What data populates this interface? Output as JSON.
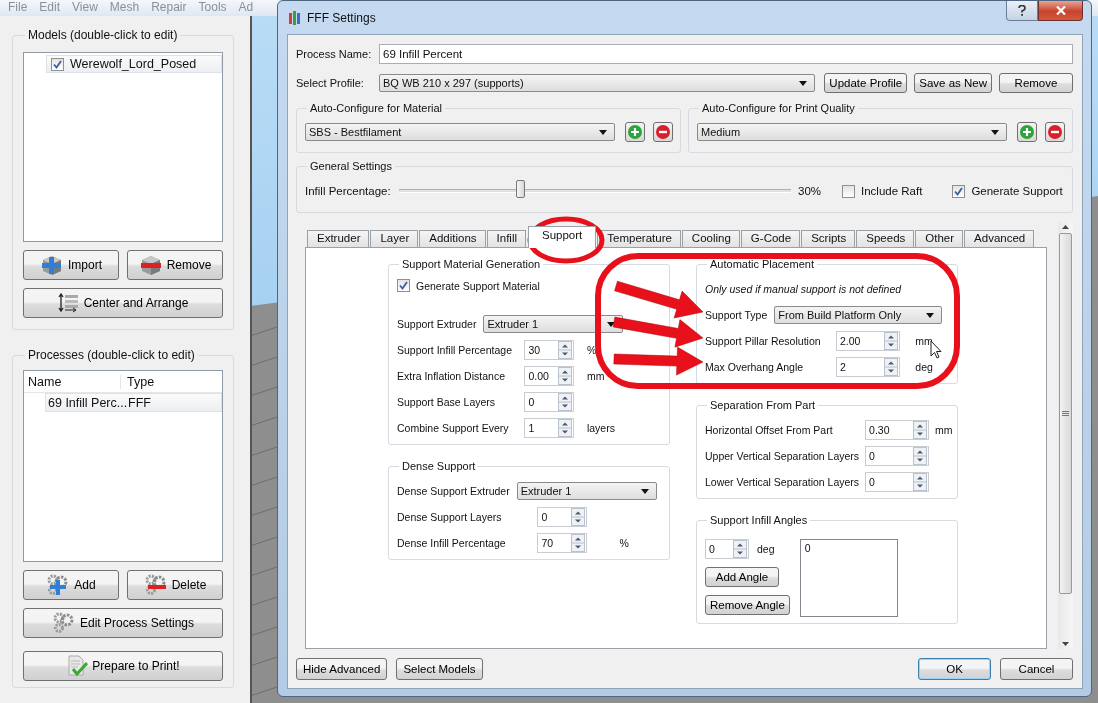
{
  "menu": [
    "File",
    "Edit",
    "View",
    "Mesh",
    "Repair",
    "Tools",
    "Ad"
  ],
  "models": {
    "title": "Models (double-click to edit)",
    "items": [
      {
        "label": "Werewolf_Lord_Posed",
        "checked": true
      }
    ],
    "buttons": [
      "Import",
      "Remove",
      "Center and Arrange"
    ]
  },
  "processes": {
    "title": "Processes (double-click to edit)",
    "columns": [
      "Name",
      "Type"
    ],
    "rows": [
      [
        "69 Infill Perc...",
        "FFF"
      ]
    ],
    "buttons": [
      "Add",
      "Delete",
      "Edit Process Settings",
      "Prepare to Print!"
    ]
  },
  "dialog": {
    "title": "FFF Settings",
    "process_name": {
      "label": "Process Name:",
      "value": "69 Infill Percent"
    },
    "profile": {
      "label": "Select Profile:",
      "value": "BQ WB 210 x 297 (supports)",
      "buttons": [
        "Update Profile",
        "Save as New",
        "Remove"
      ]
    },
    "auto_configure": [
      {
        "title": "Auto-Configure for Material",
        "value": "SBS - Bestfilament"
      },
      {
        "title": "Auto-Configure for Print Quality",
        "value": "Medium"
      }
    ],
    "general": {
      "title": "General Settings",
      "label": "Infill Percentage:",
      "level": 0.31,
      "reading": "30%",
      "checks": [
        {
          "label": "Include Raft",
          "checked": false
        },
        {
          "label": "Generate Support",
          "checked": true
        }
      ]
    },
    "tabs": [
      {
        "label": "Extruder",
        "selected": false
      },
      {
        "label": "Layer",
        "selected": false
      },
      {
        "label": "Additions",
        "selected": false
      },
      {
        "label": "Infill",
        "selected": false
      },
      {
        "label": "Support",
        "selected": true
      },
      {
        "label": "Temperature",
        "selected": false
      },
      {
        "label": "Cooling",
        "selected": false
      },
      {
        "label": "G-Code",
        "selected": false
      },
      {
        "label": "Scripts",
        "selected": false
      },
      {
        "label": "Speeds",
        "selected": false
      },
      {
        "label": "Other",
        "selected": false
      },
      {
        "label": "Advanced",
        "selected": false
      }
    ],
    "columns": [
      [
        {
          "title": "Support Material Generation",
          "rows": [
            {
              "kind": "checkbox",
              "label": "Generate Support Material",
              "checked": true
            },
            {
              "kind": "combo",
              "label": "Support Extruder",
              "value": "Extruder 1"
            },
            {
              "kind": "spin",
              "label": "Support Infill Percentage",
              "value": "30",
              "unit": "%"
            },
            {
              "kind": "spin",
              "label": "Extra Inflation Distance",
              "value": "0.00",
              "unit": "mm"
            },
            {
              "kind": "spin",
              "label": "Support Base Layers",
              "value": "0"
            },
            {
              "kind": "spin",
              "label": "Combine Support Every",
              "value": "1",
              "unit": "layers"
            }
          ]
        },
        {
          "title": "Dense Support",
          "rows": [
            {
              "kind": "combo",
              "label": "Dense Support Extruder",
              "value": "Extruder 1"
            },
            {
              "kind": "spin",
              "label": "Dense Support Layers",
              "value": "0"
            },
            {
              "kind": "spin",
              "label": "Dense Infill Percentage",
              "value": "70",
              "unit": "%"
            }
          ]
        }
      ],
      [
        {
          "title": "Automatic Placement",
          "rows": [
            {
              "kind": "note",
              "label": "Only used if manual support is not defined"
            },
            {
              "kind": "combo",
              "label": "Support Type",
              "value": "From Build Platform Only"
            },
            {
              "kind": "spin",
              "label": "Support Pillar Resolution",
              "value": "2.00",
              "unit": "mm"
            },
            {
              "kind": "spin",
              "label": "Max Overhang Angle",
              "value": "2",
              "unit": "deg"
            }
          ]
        },
        {
          "title": "Separation From Part",
          "rows": [
            {
              "kind": "spin",
              "label": "Horizontal Offset From Part",
              "value": "0.30",
              "unit": "mm"
            },
            {
              "kind": "spin",
              "label": "Upper Vertical Separation Layers",
              "value": "0"
            },
            {
              "kind": "spin",
              "label": "Lower Vertical Separation Layers",
              "value": "0"
            }
          ]
        },
        {
          "title": "Support Infill Angles",
          "rows": [
            {
              "kind": "angles",
              "value": "0",
              "unit": "deg",
              "buttons": [
                "Add Angle",
                "Remove Angle"
              ],
              "list": [
                "0"
              ]
            }
          ]
        }
      ]
    ],
    "buttons_left": [
      "Hide Advanced",
      "Select Models"
    ],
    "buttons_right": [
      "OK",
      "Cancel"
    ]
  }
}
